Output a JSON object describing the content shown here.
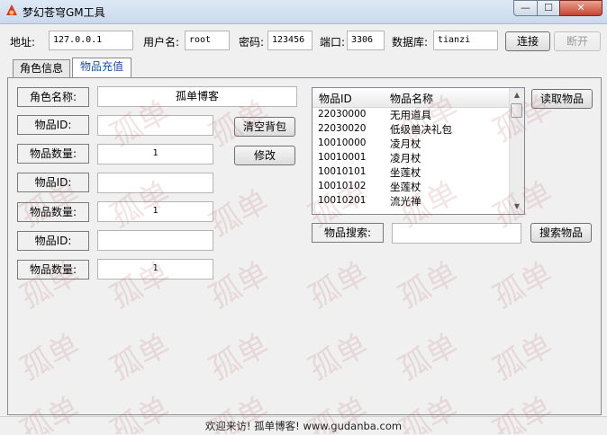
{
  "window": {
    "title": "梦幻苍穹GM工具",
    "min": "—",
    "max": "☐",
    "close": "✕"
  },
  "connection": {
    "address_label": "地址:",
    "address": "127.0.0.1",
    "user_label": "用户名:",
    "user": "root",
    "password_label": "密码:",
    "password": "123456",
    "port_label": "端口:",
    "port": "3306",
    "db_label": "数据库:",
    "db": "tianzi",
    "connect_btn": "连接",
    "disconnect_btn": "断开"
  },
  "tabs": [
    "角色信息",
    "物品充值"
  ],
  "form": {
    "role_label": "角色名称:",
    "role_value": "孤单博客",
    "id1_label": "物品ID:",
    "id1_value": "",
    "qty1_label": "物品数量:",
    "qty1_value": "1",
    "id2_label": "物品ID:",
    "id2_value": "",
    "qty2_label": "物品数量:",
    "qty2_value": "1",
    "id3_label": "物品ID:",
    "id3_value": "",
    "qty3_label": "物品数量:",
    "qty3_value": "1",
    "clear_btn": "清空背包",
    "modify_btn": "修改"
  },
  "items": {
    "headers": [
      "物品ID",
      "物品名称"
    ],
    "rows": [
      [
        "22030000",
        "无用道具"
      ],
      [
        "22030020",
        "低级兽决礼包"
      ],
      [
        "10010000",
        "凌月杖"
      ],
      [
        "10010001",
        "凌月杖"
      ],
      [
        "10010101",
        "坐莲杖"
      ],
      [
        "10010102",
        "坐莲杖"
      ],
      [
        "10010201",
        "流光禅"
      ]
    ],
    "read_btn": "读取物品",
    "search_label": "物品搜索:",
    "search_value": "",
    "search_btn": "搜索物品"
  },
  "status": "欢迎来访! 孤单博客! www.gudanba.com",
  "watermark": "孤单"
}
